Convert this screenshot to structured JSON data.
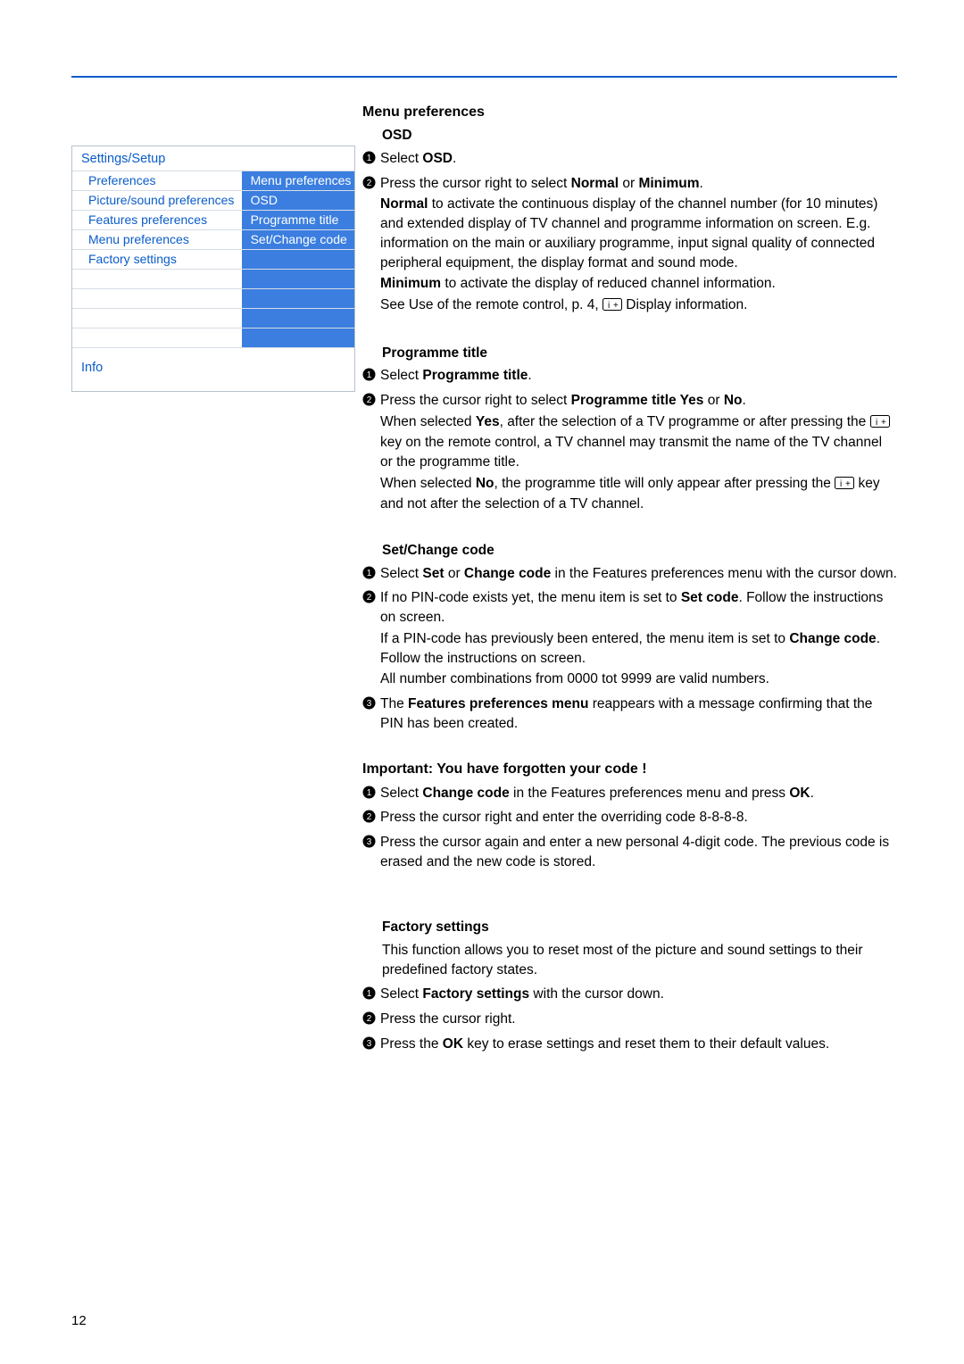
{
  "page_number": "12",
  "tvmenu": {
    "title": "Settings/Setup",
    "col_left_header": "Preferences",
    "col_right_header": "Menu preferences",
    "rows": [
      {
        "left": "Picture/sound preferences",
        "right": "OSD"
      },
      {
        "left": "Features preferences",
        "right": "Programme title"
      },
      {
        "left": "Menu preferences",
        "right": "Set/Change code"
      },
      {
        "left": "Factory settings",
        "right": ""
      }
    ],
    "info": "Info"
  },
  "sections": {
    "main_heading": "Menu preferences",
    "osd": {
      "heading": "OSD",
      "step1_a": "Select ",
      "step1_b": "OSD",
      "step1_c": ".",
      "step2_a": "Press the cursor right to select ",
      "step2_b": "Normal",
      "step2_c": " or ",
      "step2_d": "Minimum",
      "step2_e": ".",
      "step2_f": "Normal",
      "step2_g": " to activate the continuous display of the channel number (for 10 minutes) and extended display of TV channel and programme information on screen. E.g. information on the main or auxiliary programme, input signal quality of connected peripheral equipment, the display format and sound mode.",
      "step2_h": "Minimum",
      "step2_i": " to activate the display of reduced channel information.",
      "step2_j": "See Use of the remote control, p. 4, ",
      "step2_k": " Display information."
    },
    "prog": {
      "heading": "Programme title",
      "s1a": "Select ",
      "s1b": "Programme title",
      "s1c": ".",
      "s2a": "Press the cursor right to select ",
      "s2b": "Programme title Yes",
      "s2c": " or ",
      "s2d": "No",
      "s2e": ".",
      "s2f": "When selected ",
      "s2g": "Yes",
      "s2h": ", after the selection of a TV programme or after pressing the ",
      "s2i": " key on the remote control, a TV channel may transmit the name of the TV channel or the programme title.",
      "s2j": "When selected ",
      "s2k": "No",
      "s2l": ", the programme title will only appear after pressing the ",
      "s2m": " key and not after the selection of a TV channel."
    },
    "setcode": {
      "heading": "Set/Change code",
      "s1a": "Select ",
      "s1b": "Set",
      "s1c": " or ",
      "s1d": "Change code",
      "s1e": " in the Features preferences menu with the cursor down.",
      "s2a": "If no PIN-code exists yet, the menu item is set to ",
      "s2b": "Set code",
      "s2c": ". Follow the instructions on screen.",
      "s2d": "If a PIN-code has previously been entered, the menu item is set to ",
      "s2e": "Change code",
      "s2f": ". Follow the instructions on screen.",
      "s2g": "All number combinations from 0000 tot 9999 are valid numbers.",
      "s3a": "The ",
      "s3b": "Features preferences menu",
      "s3c": " reappears with a message confirming that the PIN has been created."
    },
    "forgot": {
      "heading": "Important: You have forgotten your code !",
      "s1a": "Select ",
      "s1b": "Change code",
      "s1c": " in the Features preferences menu and press ",
      "s1d": "OK",
      "s1e": ".",
      "s2": "Press the cursor right and enter the overriding code 8-8-8-8.",
      "s3": "Press the cursor again and enter a new personal 4-digit code. The previous code is erased and the new code is stored."
    },
    "factory": {
      "heading": "Factory settings",
      "intro": "This function allows you to reset most of the picture and sound settings to their predefined factory states.",
      "s1a": "Select ",
      "s1b": "Factory settings",
      "s1c": " with the cursor down.",
      "s2": "Press the cursor right.",
      "s3a": "Press the ",
      "s3b": "OK",
      "s3c": " key to erase settings and reset them to their default values."
    }
  }
}
